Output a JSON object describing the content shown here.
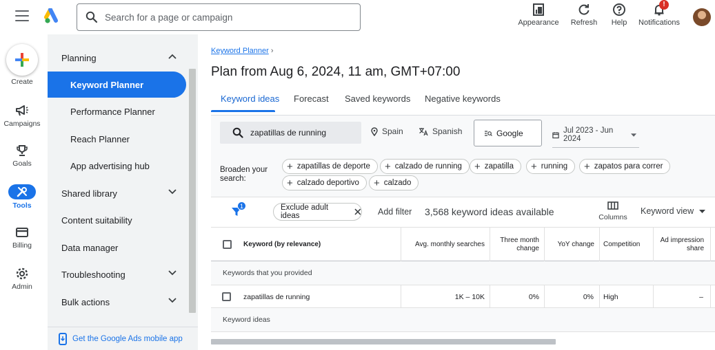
{
  "topbar": {
    "search_placeholder": "Search for a page or campaign",
    "buttons": [
      {
        "label": "Appearance",
        "icon": "appearance-icon"
      },
      {
        "label": "Refresh",
        "icon": "refresh-icon"
      },
      {
        "label": "Help",
        "icon": "help-icon"
      },
      {
        "label": "Notifications",
        "icon": "bell-icon",
        "badge": "!"
      }
    ]
  },
  "rail": {
    "create": "Create",
    "campaigns": "Campaigns",
    "goals": "Goals",
    "tools": "Tools",
    "billing": "Billing",
    "admin": "Admin"
  },
  "nav": {
    "planning": "Planning",
    "keyword_planner": "Keyword Planner",
    "performance_planner": "Performance Planner",
    "reach_planner": "Reach Planner",
    "app_advertising_hub": "App advertising hub",
    "shared_library": "Shared library",
    "content_suitability": "Content suitability",
    "data_manager": "Data manager",
    "troubleshooting": "Troubleshooting",
    "bulk_actions": "Bulk actions",
    "mobile_app": "Get the Google Ads mobile app"
  },
  "main": {
    "breadcrumb": "Keyword Planner",
    "title": "Plan from Aug 6, 2024, 11 am, GMT+07:00",
    "tabs": [
      "Keyword ideas",
      "Forecast",
      "Saved keywords",
      "Negative keywords"
    ],
    "keyword": "zapatillas de running",
    "location": "Spain",
    "language": "Spanish",
    "network": "Google",
    "date_range": "Jul 2023 - Jun 2024",
    "broaden_label": "Broaden your search:",
    "broaden_chips": [
      "zapatillas de deporte",
      "calzado de running",
      "zapatilla",
      "running",
      "zapatos para correr",
      "calzado deportivo",
      "calzado"
    ],
    "filter_badge": "1",
    "exclude_chip": "Exclude adult ideas",
    "add_filter": "Add filter",
    "ideas_count": "3,568 keyword ideas available",
    "columns_label": "Columns",
    "view_label": "Keyword view",
    "table": {
      "headers": [
        "Keyword (by relevance)",
        "Avg. monthly searches",
        "Three month change",
        "YoY change",
        "Competition",
        "Ad impression share"
      ],
      "group_provided": "Keywords that you provided",
      "row": [
        "zapatillas de running",
        "1K – 10K",
        "0%",
        "0%",
        "High",
        "–"
      ],
      "group_ideas": "Keyword ideas"
    }
  },
  "colors": {
    "accent": "#1a73e8",
    "nav_bg": "#f1f3f4"
  }
}
